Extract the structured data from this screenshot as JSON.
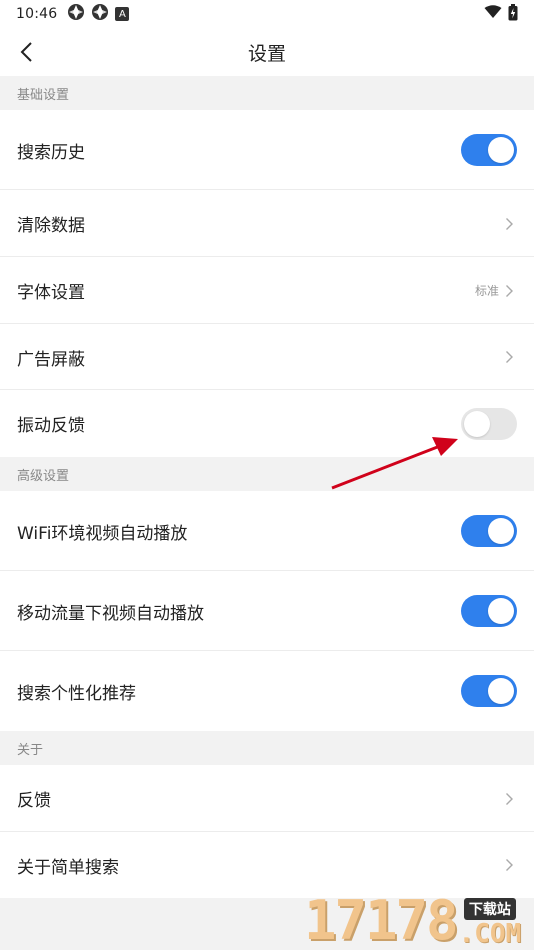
{
  "status": {
    "time": "10:46",
    "notif_letter": "A"
  },
  "nav": {
    "title": "设置"
  },
  "sections": {
    "basic": {
      "header": "基础设置",
      "search_history": "搜索历史",
      "clear_data": "清除数据",
      "font_settings": "字体设置",
      "font_value": "标准",
      "ad_block": "广告屏蔽",
      "vibration": "振动反馈"
    },
    "advanced": {
      "header": "高级设置",
      "wifi_autoplay": "WiFi环境视频自动播放",
      "mobile_autoplay": "移动流量下视频自动播放",
      "personalized": "搜索个性化推荐"
    },
    "about": {
      "header": "关于",
      "feedback": "反馈",
      "about_app": "关于简单搜索"
    }
  },
  "toggles": {
    "search_history": true,
    "vibration": false,
    "wifi_autoplay": true,
    "mobile_autoplay": true,
    "personalized": true
  },
  "watermark": {
    "digits": "17178",
    "tag": "下载站",
    "com": ".COM"
  },
  "colors": {
    "accent": "#2f80ed",
    "annotation_arrow": "#d0021b"
  }
}
